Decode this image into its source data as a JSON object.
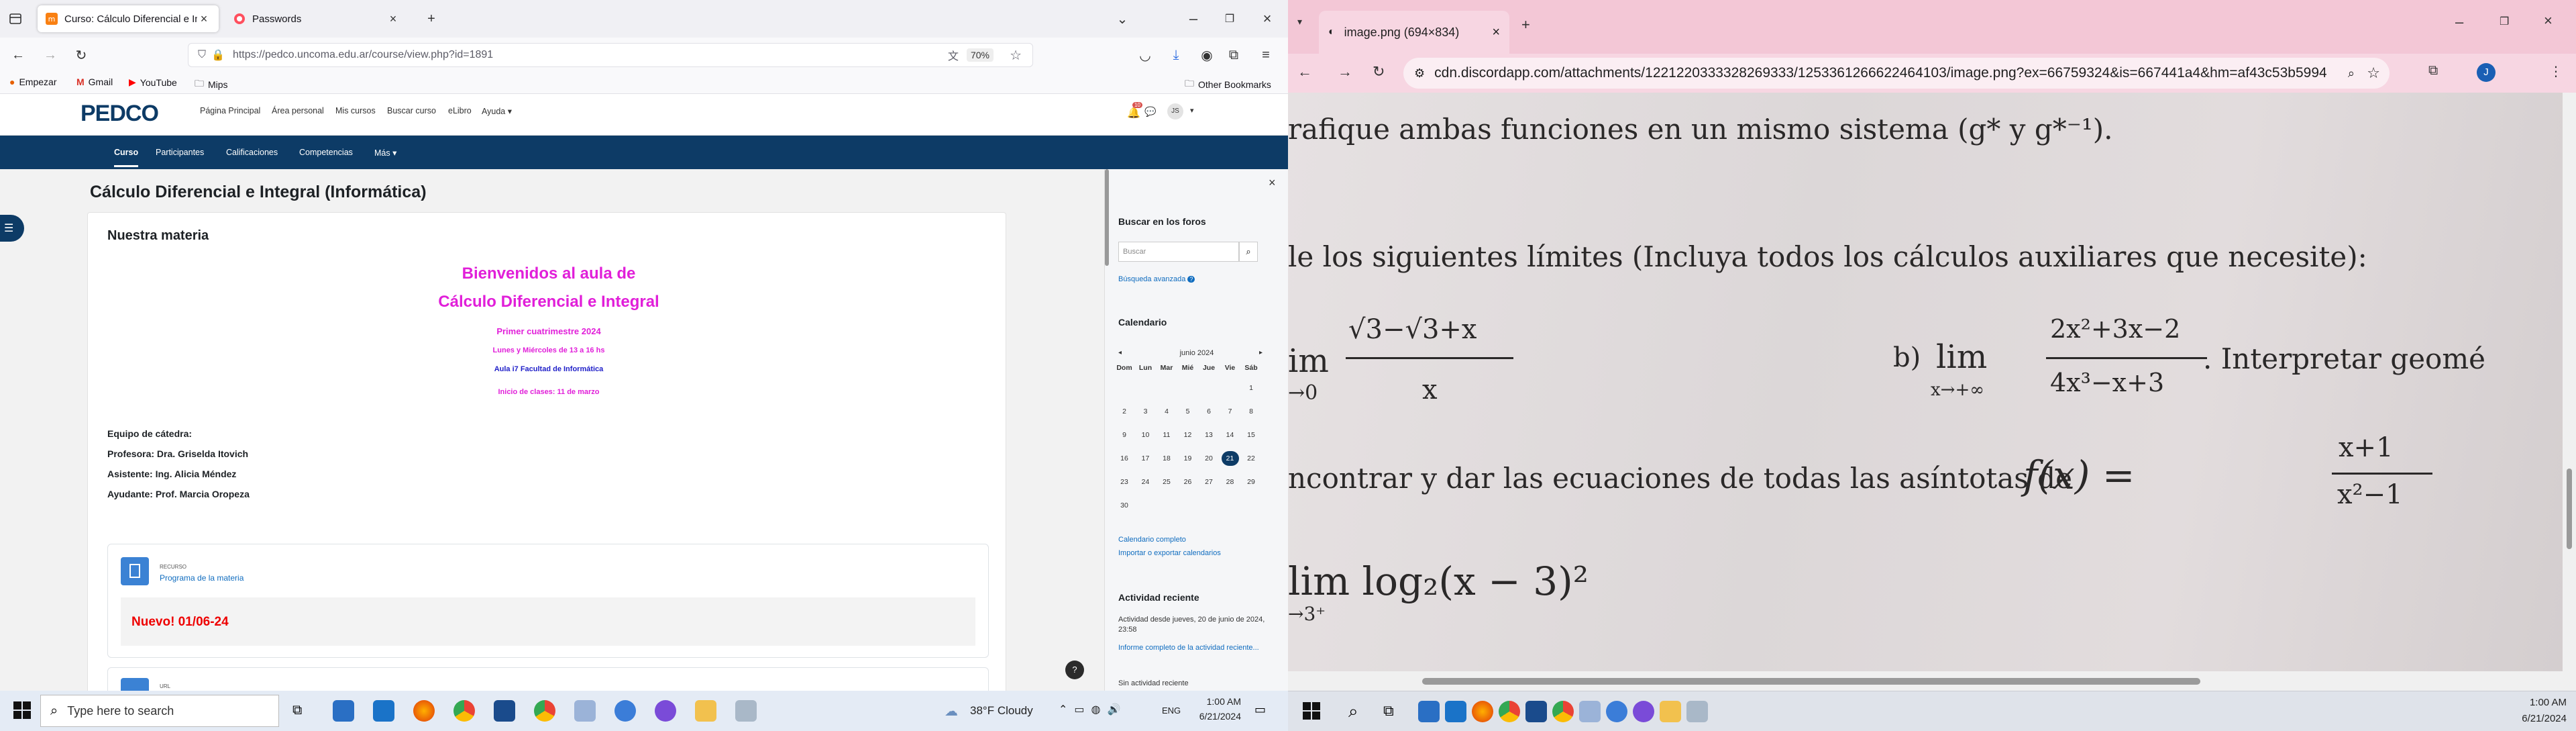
{
  "left": {
    "tabs": [
      {
        "label": "Curso: Cálculo Diferencial e In..."
      },
      {
        "label": "Passwords"
      }
    ],
    "url": "https://pedco.uncoma.edu.ar/course/view.php?id=1891",
    "zoom": "70%",
    "bookmarks": [
      "Empezar",
      "Gmail",
      "YouTube",
      "Mips"
    ],
    "other_bookmarks": "Other Bookmarks",
    "moodle": {
      "logo": "PEDCO",
      "topnav": [
        "Página Principal",
        "Área personal",
        "Mis cursos",
        "Buscar curso",
        "eLibro",
        "Ayuda"
      ],
      "notif_count": "10",
      "user_initials": "JS",
      "menu": [
        "Curso",
        "Participantes",
        "Calificaciones",
        "Competencias",
        "Más"
      ],
      "course_title": "Cálculo Diferencial e Integral (Informática)",
      "section_title": "Nuestra materia",
      "welcome1": "Bienvenidos al aula de",
      "welcome2": "Cálculo Diferencial e Integral",
      "term": "Primer cuatrimestre 2024",
      "schedule": "Lunes y Miércoles de 13 a 16 hs",
      "room": "Aula i7 Facultad de Informática",
      "start": "Inicio de clases: 11 de marzo",
      "staff_title": "Equipo de cátedra:",
      "staff": [
        "Profesora: Dra. Griselda Itovich",
        "Asistente: Ing. Alicia Méndez",
        "Ayudante: Prof. Marcia Oropeza"
      ],
      "resource_type": "RECURSO",
      "resource_name": "Programa de la materia",
      "nuevo": "Nuevo!  01/06-24",
      "url_type": "URL",
      "help": "?",
      "drawer": {
        "close": "×",
        "forum_title": "Buscar en los foros",
        "search_placeholder": "Buscar",
        "advanced": "Búsqueda avanzada",
        "cal_title": "Calendario",
        "month": "junio 2024",
        "days": [
          "Dom",
          "Lun",
          "Mar",
          "Mié",
          "Jue",
          "Vie",
          "Sáb"
        ],
        "weeks": [
          [
            "",
            "",
            "",
            "",
            "",
            "",
            "1"
          ],
          [
            "2",
            "3",
            "4",
            "5",
            "6",
            "7",
            "8"
          ],
          [
            "9",
            "10",
            "11",
            "12",
            "13",
            "14",
            "15"
          ],
          [
            "16",
            "17",
            "18",
            "19",
            "20",
            "21",
            "22"
          ],
          [
            "23",
            "24",
            "25",
            "26",
            "27",
            "28",
            "29"
          ],
          [
            "30",
            "",
            "",
            "",
            "",
            "",
            ""
          ]
        ],
        "today": "21",
        "cal_full": "Calendario completo",
        "cal_export": "Importar o exportar calendarios",
        "activity_title": "Actividad reciente",
        "activity_since": "Actividad desde jueves, 20 de junio de 2024, 23:58",
        "activity_report": "Informe completo de la actividad reciente...",
        "no_activity": "Sin actividad reciente"
      }
    },
    "taskbar": {
      "search": "Type here to search",
      "weather": "38°F  Cloudy",
      "lang": "ENG",
      "time": "1:00 AM",
      "date": "6/21/2024"
    }
  },
  "right": {
    "tab": "image.png (694×834)",
    "url": "cdn.discordapp.com/attachments/1221220333328269333/1253361266622464103/image.png?ex=66759324&is=667441a4&hm=af43c53b59940c1...",
    "profile": "J",
    "photo_text": {
      "line1": "rafique ambas funciones en un mismo sistema (g* y g*⁻¹).",
      "line2": "le los siguientes límites (Incluya todos los cálculos auxiliares que necesite):",
      "a_lim": "im",
      "a_sub": "→0",
      "a_num": "√3−√3+x",
      "a_den": "x",
      "b_label": "b)",
      "b_lim": "lim",
      "b_sub": "x→+∞",
      "b_num": "2x²+3x−2",
      "b_den": "4x³−x+3",
      "b_tail": ". Interpretar geomé",
      "line4": "ncontrar y dar las ecuaciones de todas las asíntotas de",
      "fx": "f(x) =",
      "f_num": "x+1",
      "f_den": "x²−1",
      "lim4": "lim  log₂(x − 3)²",
      "lim4_sub": "→3⁺"
    },
    "taskbar": {
      "time": "1:00 AM",
      "date": "6/21/2024"
    }
  },
  "colors": {
    "moodle_blue": "#0d3b66",
    "pink": "#e11fd9",
    "chrome_pink": "#f3c7d6"
  }
}
